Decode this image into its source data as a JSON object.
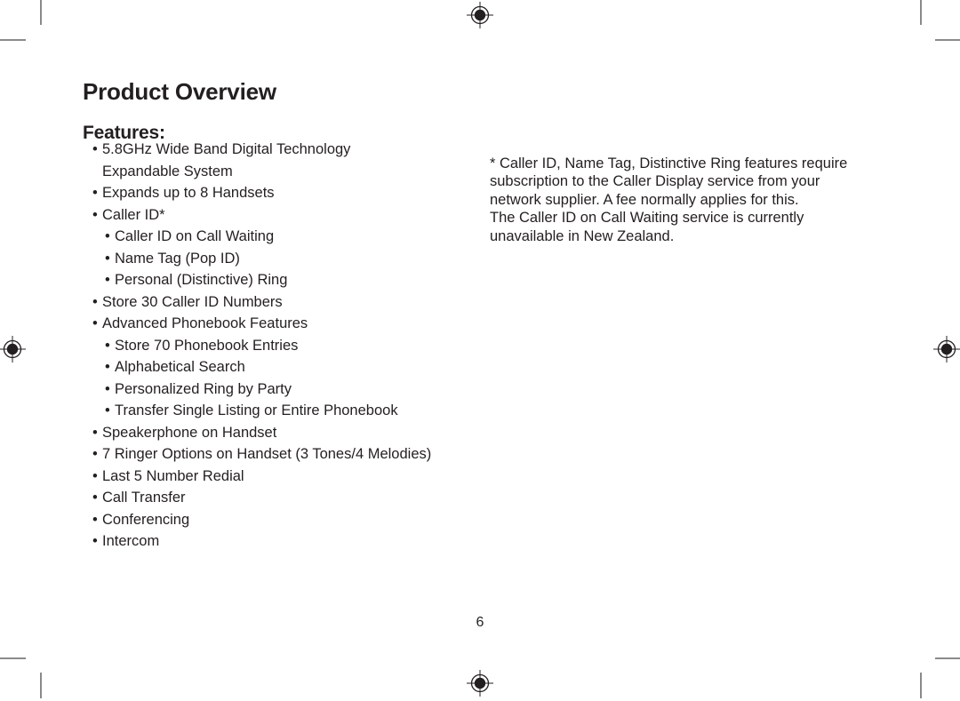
{
  "document": {
    "page_title": "Product Overview",
    "section_title": "Features:",
    "page_number": "6"
  },
  "features": [
    {
      "level": 1,
      "text": "5.8GHz Wide Band Digital Technology\nExpandable System"
    },
    {
      "level": 1,
      "text": "Expands up to 8 Handsets"
    },
    {
      "level": 1,
      "text": "Caller ID*"
    },
    {
      "level": 2,
      "text": "Caller ID on Call Waiting"
    },
    {
      "level": 2,
      "text": "Name Tag (Pop ID)"
    },
    {
      "level": 2,
      "text": "Personal (Distinctive) Ring"
    },
    {
      "level": 1,
      "text": "Store 30 Caller ID Numbers"
    },
    {
      "level": 1,
      "text": "Advanced Phonebook Features"
    },
    {
      "level": 2,
      "text": "Store 70 Phonebook Entries"
    },
    {
      "level": 2,
      "text": "Alphabetical Search"
    },
    {
      "level": 2,
      "text": "Personalized Ring by Party"
    },
    {
      "level": 2,
      "text": "Transfer Single Listing or Entire Phonebook"
    },
    {
      "level": 1,
      "text": "Speakerphone on Handset"
    },
    {
      "level": 1,
      "text": "7 Ringer Options on Handset (3 Tones/4 Melodies)"
    },
    {
      "level": 1,
      "text": "Last 5 Number Redial"
    },
    {
      "level": 1,
      "text": "Call Transfer"
    },
    {
      "level": 1,
      "text": "Conferencing"
    },
    {
      "level": 1,
      "text": "Intercom"
    }
  ],
  "footnote": {
    "text": "* Caller ID, Name Tag, Distinctive Ring features require\nsubscription to the Caller Display service from your\nnetwork supplier. A fee normally applies for this.\nThe Caller ID on Call Waiting service is currently\nunavailable in New Zealand."
  },
  "print_marks": {
    "bullet_glyph": "•",
    "crop_mark_color": "#8a8a8a",
    "registration_color": "#231f20",
    "text_color": "#231f20"
  }
}
